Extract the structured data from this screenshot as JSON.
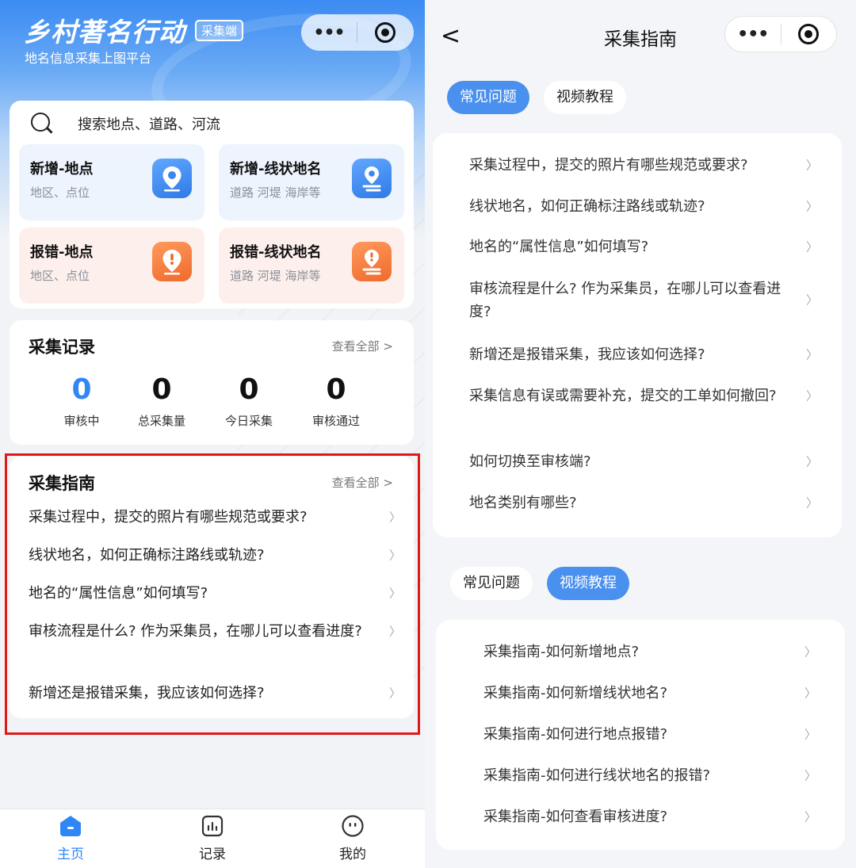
{
  "left": {
    "brand": {
      "title": "乡村著名行动",
      "tag": "采集端",
      "subtitle": "地名信息采集上图平台"
    },
    "search": {
      "placeholder": "搜索地点、道路、河流"
    },
    "actions": [
      {
        "title": "新增-地点",
        "subtitle": "地区、点位"
      },
      {
        "title": "新增-线状地名",
        "subtitle": "道路 河堤 海岸等"
      },
      {
        "title": "报错-地点",
        "subtitle": "地区、点位"
      },
      {
        "title": "报错-线状地名",
        "subtitle": "道路 河堤 海岸等"
      }
    ],
    "records": {
      "title": "采集记录",
      "more": "查看全部 >",
      "stats": [
        {
          "value": "0",
          "label": "审核中"
        },
        {
          "value": "0",
          "label": "总采集量"
        },
        {
          "value": "0",
          "label": "今日采集"
        },
        {
          "value": "0",
          "label": "审核通过"
        }
      ]
    },
    "guide": {
      "title": "采集指南",
      "more": "查看全部 >",
      "items": [
        "采集过程中，提交的照片有哪些规范或要求?",
        "线状地名，如何正确标注路线或轨迹?",
        "地名的“属性信息”如何填写?",
        "审核流程是什么? 作为采集员，在哪儿可以查看进度?",
        "新增还是报错采集，我应该如何选择?"
      ]
    },
    "tabbar": [
      {
        "label": "主页",
        "icon": "home-icon"
      },
      {
        "label": "记录",
        "icon": "chart-icon"
      },
      {
        "label": "我的",
        "icon": "smile-icon"
      }
    ]
  },
  "right": {
    "title": "采集指南",
    "back": "<",
    "tabs_top": {
      "faq": "常见问题",
      "video": "视频教程"
    },
    "faq_items": [
      "采集过程中，提交的照片有哪些规范或要求?",
      "线状地名，如何正确标注路线或轨迹?",
      "地名的“属性信息”如何填写?",
      "审核流程是什么? 作为采集员，在哪儿可以查看进度?",
      "新增还是报错采集，我应该如何选择?",
      "采集信息有误或需要补充，提交的工单如何撤回?",
      "如何切换至审核端?",
      "地名类别有哪些?"
    ],
    "tabs_bottom": {
      "faq": "常见问题",
      "video": "视频教程"
    },
    "video_items": [
      "采集指南-如何新增地点?",
      "采集指南-如何新增线状地名?",
      "采集指南-如何进行地点报错?",
      "采集指南-如何进行线状地名的报错?",
      "采集指南-如何查看审核进度?"
    ]
  },
  "colors": {
    "accent": "#2f86f5",
    "orange": "#ef6a2c",
    "highlight": "#e01818"
  }
}
